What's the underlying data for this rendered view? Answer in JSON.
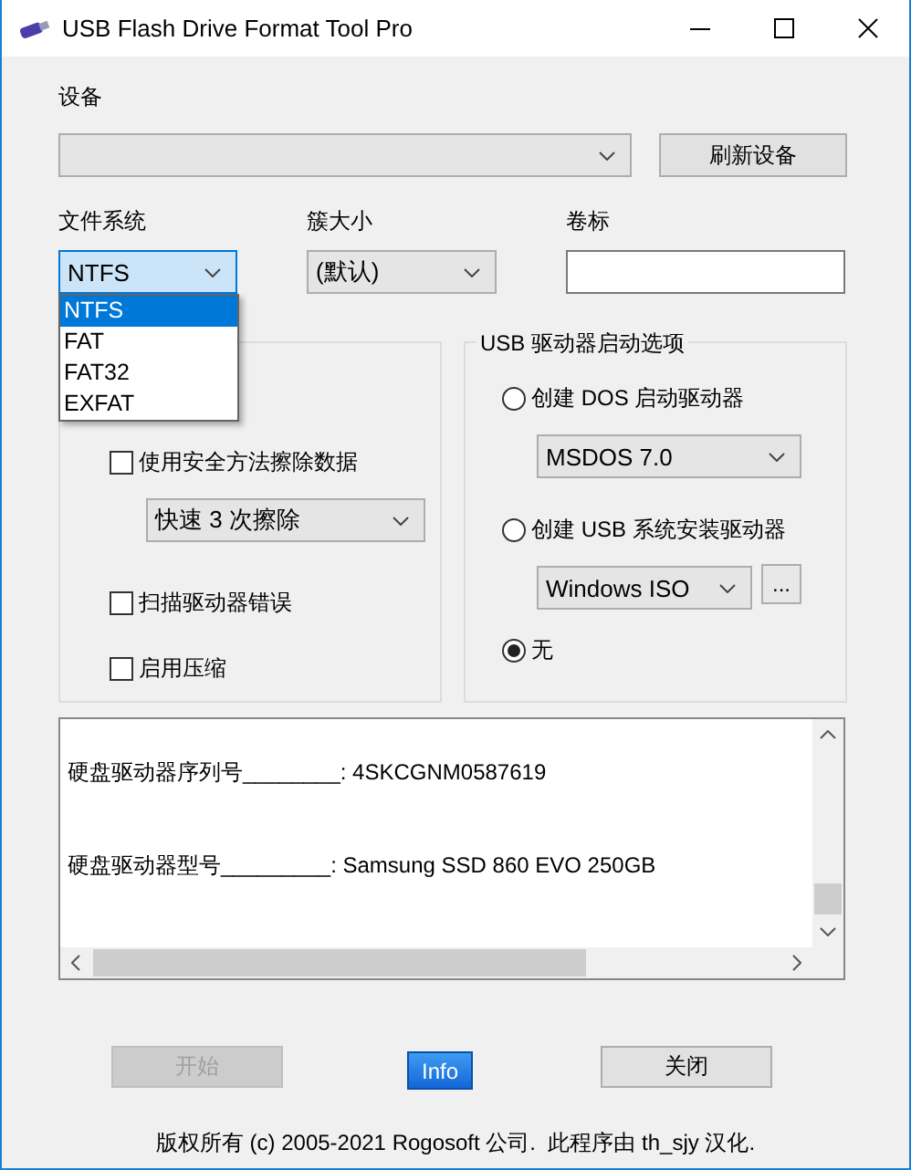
{
  "window": {
    "title": "USB Flash Drive Format Tool Pro"
  },
  "device": {
    "label": "设备",
    "refresh_button": "刷新设备"
  },
  "file_system": {
    "label": "文件系统",
    "value": "NTFS",
    "expanded": true,
    "options": [
      {
        "label": "NTFS",
        "selected": true
      },
      {
        "label": "FAT",
        "selected": false
      },
      {
        "label": "FAT32",
        "selected": false
      },
      {
        "label": "EXFAT",
        "selected": false
      }
    ]
  },
  "cluster_size": {
    "label": "簇大小",
    "value": "(默认)"
  },
  "volume_label": {
    "label": "卷标"
  },
  "format_options": {
    "items": [
      {
        "kind": "checkbox",
        "label": "使用安全方法擦除数据",
        "checked": false
      },
      {
        "kind": "combo",
        "value": "快速 3 次擦除"
      },
      {
        "kind": "checkbox",
        "label": "扫描驱动器错误",
        "checked": false
      },
      {
        "kind": "checkbox",
        "label": "启用压缩",
        "checked": false
      }
    ]
  },
  "boot_options": {
    "title": "USB 驱动器启动选项",
    "items": [
      {
        "kind": "radio",
        "label": "创建 DOS 启动驱动器",
        "selected": false
      },
      {
        "kind": "combo",
        "value": "MSDOS 7.0"
      },
      {
        "kind": "radio",
        "label": "创建 USB 系统安装驱动器",
        "selected": false
      },
      {
        "kind": "combo",
        "value": "Windows ISO",
        "browse": "..."
      },
      {
        "kind": "radio",
        "label": "无",
        "selected": true
      }
    ]
  },
  "log": {
    "lines": [
      "硬盘驱动器序列号________: 4SKCGNM0587619",
      "硬盘驱动器型号_________: Samsung SSD 860 EVO 250GB"
    ]
  },
  "buttons": [
    {
      "label": "开始",
      "kind": "plain",
      "disabled": true
    },
    {
      "label": "Info",
      "kind": "accent",
      "disabled": false
    },
    {
      "label": "关闭",
      "kind": "plain",
      "disabled": false
    }
  ],
  "footer": "版权所有 (c) 2005-2021 Rogosoft 公司.  此程序由 th_sjy 汉化."
}
